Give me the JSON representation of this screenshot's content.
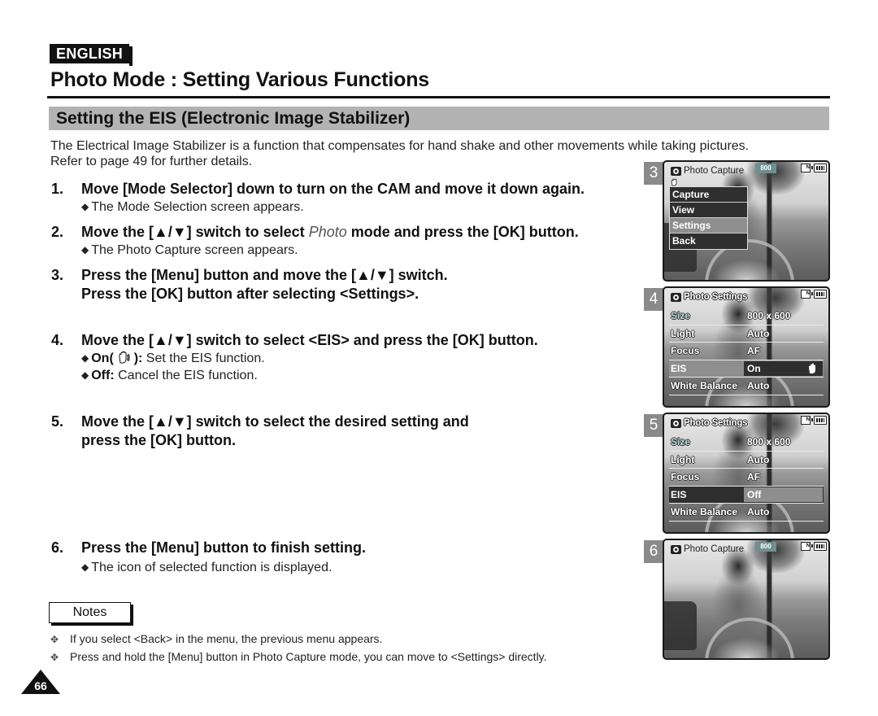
{
  "header": {
    "language_badge": "ENGLISH",
    "page_title": "Photo Mode : Setting Various Functions",
    "section_title": "Setting the EIS (Electronic Image Stabilizer)"
  },
  "intro": {
    "line1": "The Electrical Image Stabilizer is a function that compensates for hand shake and other movements while taking pictures.",
    "line2": "Refer to page 49 for further details."
  },
  "steps": [
    {
      "num": "1.",
      "text": "Move [Mode Selector] down to turn on the CAM and move it down again.",
      "sub": [
        "The Mode Selection screen appears."
      ]
    },
    {
      "num": "2.",
      "text_before": "Move the [▲/▼] switch to select ",
      "text_em": "Photo",
      "text_after": " mode and press the [OK] button.",
      "sub": [
        "The Photo Capture screen appears."
      ]
    },
    {
      "num": "3.",
      "line1": "Press the [Menu] button and move the [▲/▼] switch.",
      "line2": "Press the [OK] button after selecting <Settings>."
    },
    {
      "num": "4.",
      "text": "Move the [▲/▼] switch to select <EIS> and press the [OK] button.",
      "options": [
        {
          "label": "On(",
          "label_close": "):",
          "desc": "Set the EIS function.",
          "icon": "eis-hand-icon"
        },
        {
          "label": "Off",
          "label_close": ":",
          "desc": "Cancel the EIS function."
        }
      ]
    },
    {
      "num": "5.",
      "line1": "Move the [▲/▼] switch to select the desired setting and",
      "line2": "press the [OK] button."
    },
    {
      "num": "6.",
      "text": "Press the [Menu] button to finish setting.",
      "sub": [
        "The icon of selected function is displayed."
      ]
    }
  ],
  "notes": {
    "label": "Notes",
    "items": [
      "If you select <Back> in the menu, the previous menu appears.",
      "Press and hold the [Menu] button in Photo Capture mode, you can move to <Settings> directly."
    ]
  },
  "page_number": "66",
  "screens": [
    {
      "step": "3",
      "title": "Photo Capture",
      "resolution_badge": "800",
      "menu": [
        {
          "label": "Capture",
          "selected": false
        },
        {
          "label": "View",
          "selected": false
        },
        {
          "label": "Settings",
          "selected": true
        },
        {
          "label": "Back",
          "selected": false
        }
      ]
    },
    {
      "step": "4",
      "title": "Photo Settings",
      "settings": [
        {
          "label": "Size",
          "value": "800 x 600"
        },
        {
          "label": "Light",
          "value": "Auto"
        },
        {
          "label": "Focus",
          "value": "AF"
        },
        {
          "label": "EIS",
          "value": "On",
          "highlighted": true
        },
        {
          "label": "White Balance",
          "value": "Auto"
        }
      ]
    },
    {
      "step": "5",
      "title": "Photo Settings",
      "settings": [
        {
          "label": "Size",
          "value": "800 x 600"
        },
        {
          "label": "Light",
          "value": "Auto"
        },
        {
          "label": "Focus",
          "value": "AF"
        },
        {
          "label": "EIS",
          "value": "Off",
          "highlighted": true
        },
        {
          "label": "White Balance",
          "value": "Auto"
        }
      ]
    },
    {
      "step": "6",
      "title": "Photo Capture",
      "resolution_badge": "800"
    }
  ]
}
